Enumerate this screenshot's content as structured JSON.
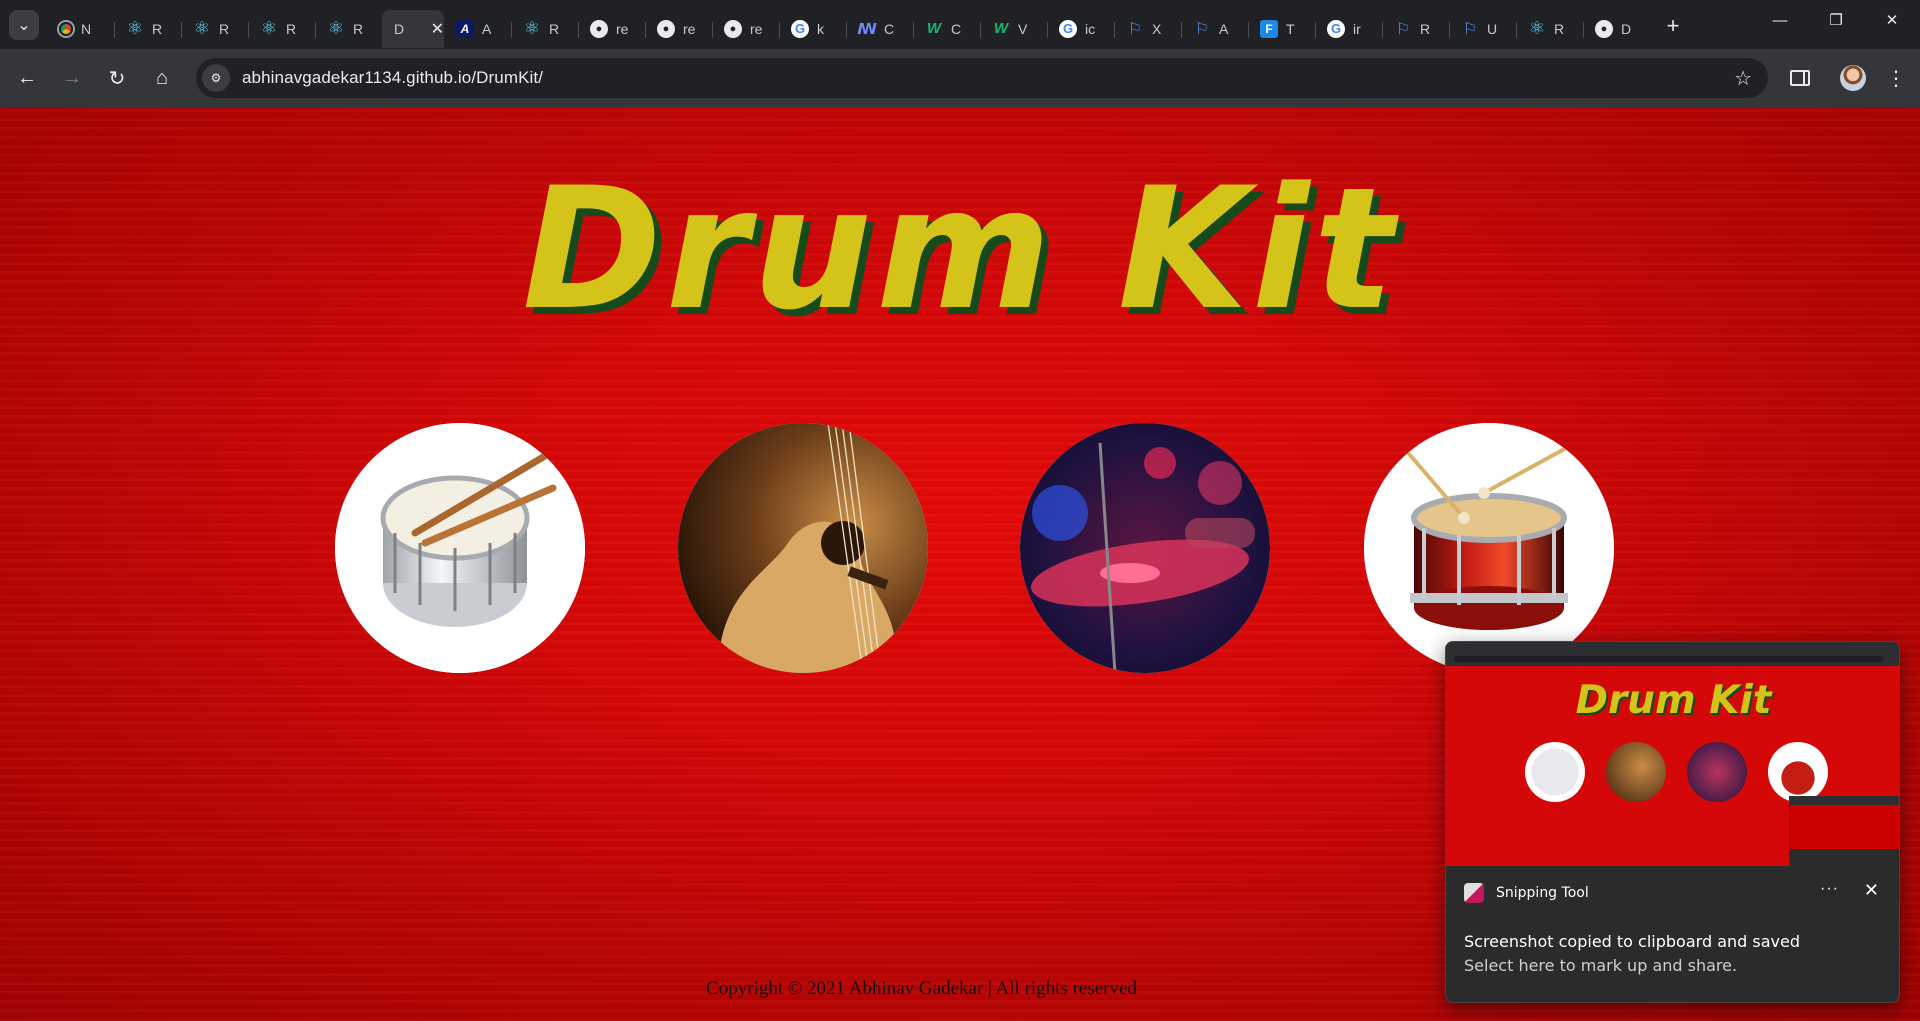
{
  "browser": {
    "tabs": [
      {
        "icon": "chrome-icon",
        "glyph": "",
        "label": "N"
      },
      {
        "icon": "react-icon",
        "glyph": "⚛",
        "label": "R"
      },
      {
        "icon": "react-icon",
        "glyph": "⚛",
        "label": "R"
      },
      {
        "icon": "react-icon",
        "glyph": "⚛",
        "label": "R"
      },
      {
        "icon": "react-icon",
        "glyph": "⚛",
        "label": "R"
      },
      {
        "icon": "page-icon",
        "glyph": "D",
        "label": "",
        "active": true
      },
      {
        "icon": "a-app-icon",
        "glyph": "A",
        "label": "A"
      },
      {
        "icon": "react-icon",
        "glyph": "⚛",
        "label": "R"
      },
      {
        "icon": "github-icon",
        "glyph": "●",
        "label": "re"
      },
      {
        "icon": "github-icon",
        "glyph": "●",
        "label": "re"
      },
      {
        "icon": "github-icon",
        "glyph": "●",
        "label": "re"
      },
      {
        "icon": "google-icon",
        "glyph": "G",
        "label": "k"
      },
      {
        "icon": "codecademy-icon",
        "glyph": "ꟿ",
        "label": "C"
      },
      {
        "icon": "w-icon",
        "glyph": "W",
        "label": "C"
      },
      {
        "icon": "w-icon",
        "glyph": "W",
        "label": "V"
      },
      {
        "icon": "google-icon",
        "glyph": "G",
        "label": "ic"
      },
      {
        "icon": "flag-icon",
        "glyph": "⚐",
        "label": "X"
      },
      {
        "icon": "flag-icon",
        "glyph": "⚐",
        "label": "A"
      },
      {
        "icon": "f-app-icon",
        "glyph": "F",
        "label": "T"
      },
      {
        "icon": "google-icon",
        "glyph": "G",
        "label": "ir"
      },
      {
        "icon": "flag-icon",
        "glyph": "⚐",
        "label": "R"
      },
      {
        "icon": "flag-icon",
        "glyph": "⚐",
        "label": "U"
      },
      {
        "icon": "react-icon",
        "glyph": "⚛",
        "label": "R"
      },
      {
        "icon": "github-icon",
        "glyph": "●",
        "label": "D"
      }
    ],
    "new_tab_label": "+",
    "url": "abhinavgadekar1134.github.io/DrumKit/"
  },
  "page": {
    "title": "Drum Kit",
    "buttons": [
      {
        "name": "snare-drum-button",
        "kind": "snare"
      },
      {
        "name": "guitar-button",
        "kind": "guitar"
      },
      {
        "name": "cymbal-button",
        "kind": "cymbal"
      },
      {
        "name": "bass-drum-button",
        "kind": "bass"
      }
    ],
    "footer": "Copyright © 2021 Abhinav Gadekar | All rights reserved",
    "colors": {
      "background": "#d60808",
      "title": "#d4c41a",
      "title_shadow": "#174a1a"
    }
  },
  "toast": {
    "app_name": "Snipping Tool",
    "preview_title": "Drum Kit",
    "message": "Screenshot copied to clipboard and saved",
    "sub_message": "Select here to mark up and share.",
    "more_label": "···",
    "close_label": "✕"
  }
}
